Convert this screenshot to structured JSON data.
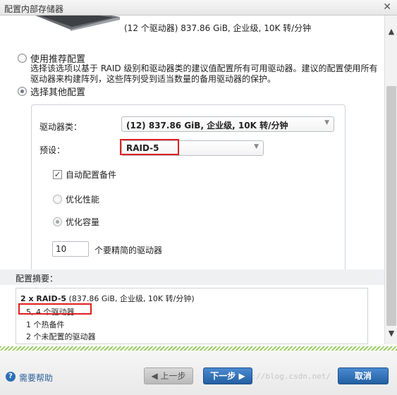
{
  "window": {
    "title": "配置内部存储器",
    "close_icon": "close-icon"
  },
  "drive_summary_text": "(12 个驱动器) 837.86 GiB, 企业级, 10K 转/分钟",
  "options": {
    "recommended": {
      "label": "使用推荐配置",
      "description": "选择该选项以基于 RAID 级别和驱动器类的建议值配置所有可用驱动器。建议的配置使用所有驱动器来构建阵列，这些阵列受到适当数量的备用驱动器的保护。"
    },
    "other": {
      "label": "选择其他配置"
    }
  },
  "form": {
    "drive_class_label": "驱动器类：",
    "drive_class_value": "(12) 837.86 GiB, 企业级, 10K 转/分钟",
    "preset_label": "预设：",
    "preset_value": "RAID-5",
    "auto_spare_label": "自动配置备件",
    "optimize_perf_label": "优化性能",
    "optimize_cap_label": "优化容量",
    "drive_count_value": "10",
    "drive_count_label": "个要精简的驱动器"
  },
  "summary": {
    "heading": "配置摘要：",
    "line1_bold": "2 x RAID-5",
    "line1_rest": " (837.86 GiB, 企业级, 10K 转/分钟)",
    "line2": "5, 4 个驱动器",
    "line3": "1 个热备件",
    "line4": "2 个未配置的驱动器"
  },
  "footer": {
    "help": "需要帮助",
    "prev": "◀ 上一步",
    "next": "下一步 ▶",
    "cancel": "取消",
    "watermark": "http://blog.csdn.net/"
  }
}
